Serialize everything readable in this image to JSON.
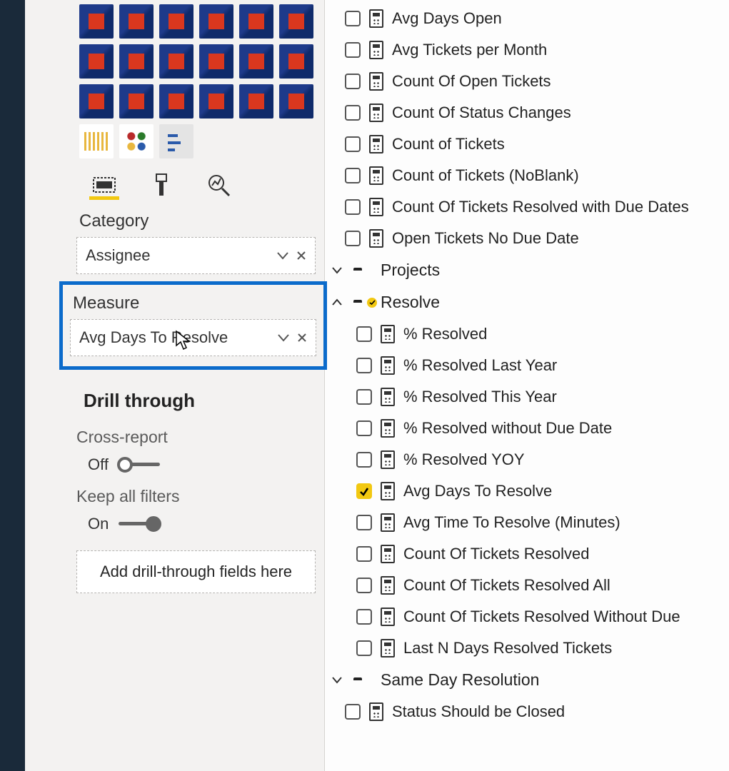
{
  "viz_panel": {
    "tabs": {
      "fields": "Fields",
      "format": "Format",
      "analytics": "Analytics"
    },
    "category_label": "Category",
    "category_field": "Assignee",
    "measure_label": "Measure",
    "measure_field": "Avg Days To Resolve",
    "drill_heading": "Drill through",
    "cross_report_label": "Cross-report",
    "cross_report_state": "Off",
    "keep_filters_label": "Keep all filters",
    "keep_filters_state": "On",
    "drill_placeholder": "Add drill-through fields here"
  },
  "fields": {
    "top_measures": [
      "Avg Days Open",
      "Avg Tickets per Month",
      "Count Of Open Tickets",
      "Count Of Status Changes",
      "Count of Tickets",
      "Count of Tickets (NoBlank)",
      "Count Of Tickets Resolved with Due Dates",
      "Open Tickets No Due Date"
    ],
    "projects_group": "Projects",
    "resolve_group": "Resolve",
    "resolve_items": [
      {
        "label": "% Resolved",
        "checked": false
      },
      {
        "label": "% Resolved Last Year",
        "checked": false
      },
      {
        "label": "% Resolved This Year",
        "checked": false
      },
      {
        "label": "% Resolved without Due Date",
        "checked": false
      },
      {
        "label": "% Resolved YOY",
        "checked": false
      },
      {
        "label": "Avg Days To Resolve",
        "checked": true
      },
      {
        "label": "Avg Time To Resolve (Minutes)",
        "checked": false
      },
      {
        "label": "Count Of Tickets Resolved",
        "checked": false
      },
      {
        "label": "Count Of Tickets Resolved All",
        "checked": false
      },
      {
        "label": "Count Of Tickets Resolved Without Due",
        "checked": false
      },
      {
        "label": "Last N Days Resolved Tickets",
        "checked": false
      }
    ],
    "same_day_group": "Same Day Resolution",
    "same_day_items": [
      {
        "label": "Status Should be Closed",
        "checked": false
      }
    ]
  }
}
